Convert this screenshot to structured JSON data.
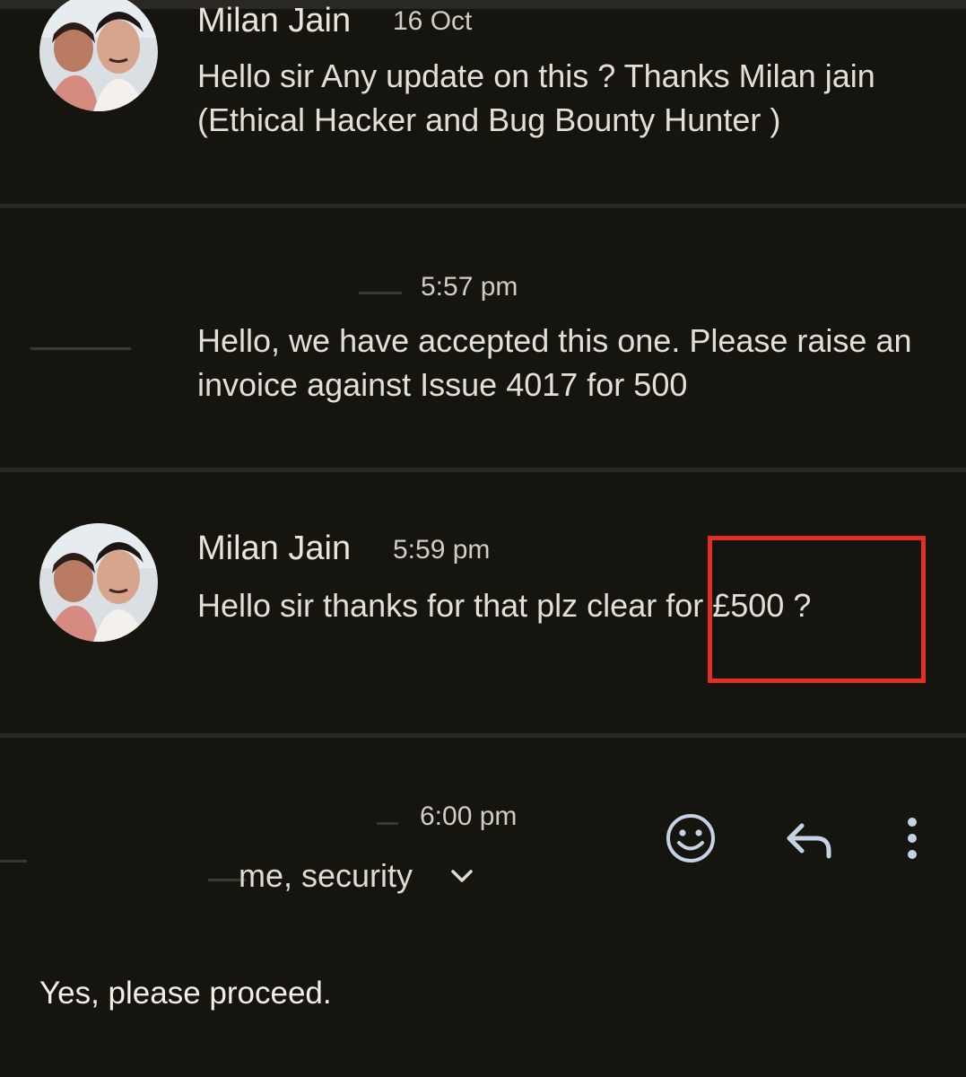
{
  "messages": [
    {
      "sender": "Milan Jain",
      "time": "16 Oct",
      "body": "Hello sir Any update on this ? Thanks Milan jain (Ethical Hacker and Bug Bounty Hunter )"
    },
    {
      "sender": "",
      "time": "5:57 pm",
      "body": "Hello, we have accepted this one. Please raise an invoice against Issue 4017 for 500"
    },
    {
      "sender": "Milan Jain",
      "time": "5:59 pm",
      "body": "Hello sir thanks for that plz clear for £500 ?"
    },
    {
      "sender": "",
      "time": "6:00 pm",
      "recipients": "me, security",
      "body": "Yes, please proceed."
    }
  ],
  "icons": {
    "emoji": "emoji-react-icon",
    "reply": "reply-icon",
    "more": "more-options-icon",
    "expand": "chevron-down-icon"
  },
  "colors": {
    "background": "#16140f",
    "highlight": "#e2301f",
    "icon": "#c4d3e3"
  }
}
